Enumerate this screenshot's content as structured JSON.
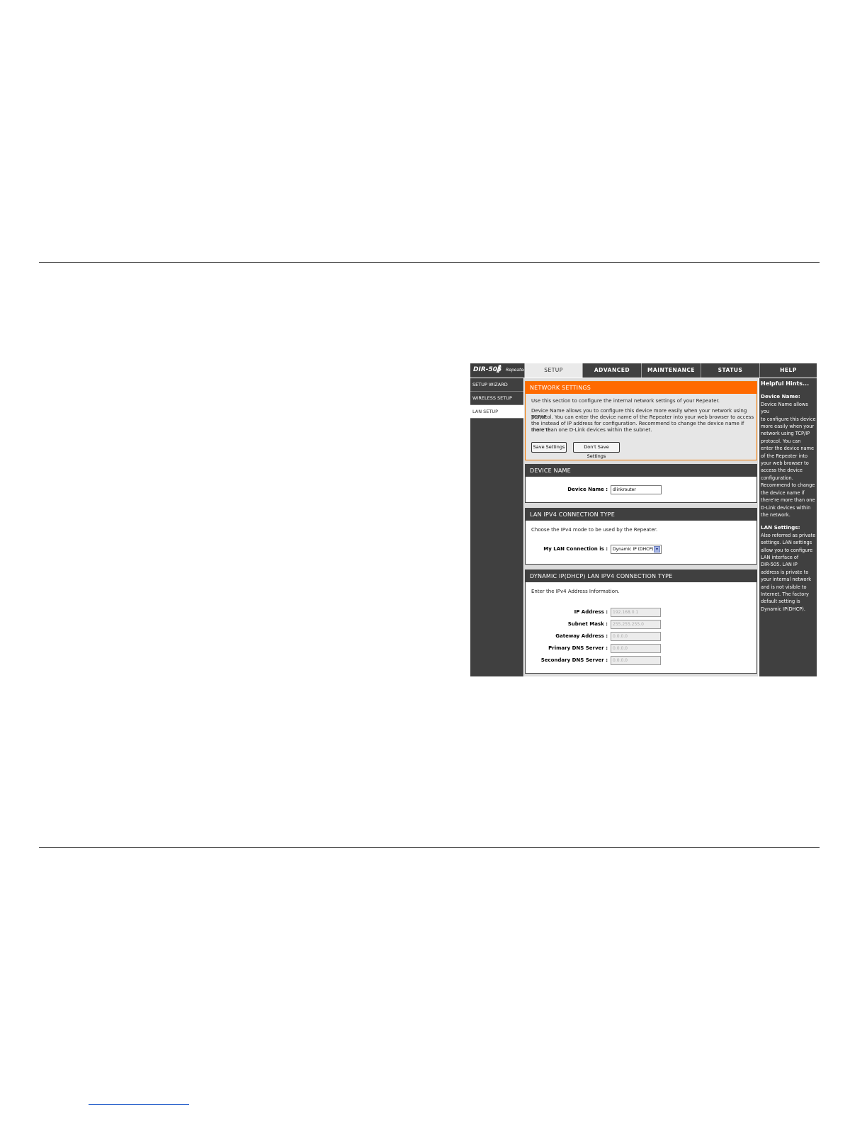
{
  "document": {
    "footer_link_text": ""
  },
  "app": {
    "model": "DIR-505",
    "mode": "Repeater"
  },
  "tabs": [
    {
      "label": "SETUP",
      "active": true
    },
    {
      "label": "ADVANCED",
      "active": false
    },
    {
      "label": "MAINTENANCE",
      "active": false
    },
    {
      "label": "STATUS",
      "active": false
    },
    {
      "label": "HELP",
      "active": false
    }
  ],
  "sidebar": {
    "items": [
      {
        "label": "SETUP WIZARD",
        "active": false
      },
      {
        "label": "WIRELESS SETUP",
        "active": false
      },
      {
        "label": "LAN SETUP",
        "active": true
      }
    ]
  },
  "network_settings": {
    "title": "NETWORK SETTINGS",
    "intro": "Use this section to configure the internal network settings of your Repeater.",
    "desc_lines": [
      "Device Name allows you to configure this device more easily when your network using TCP/IP",
      "protocol. You can enter the device name of the Repeater into your web browser to access",
      "the instead of IP address for configuration. Recommend to change the device name if there're",
      "more than one D-Link devices within the subnet."
    ],
    "save_label": "Save Settings",
    "dont_save_label": "Don't Save Settings"
  },
  "device_name": {
    "title": "DEVICE NAME",
    "label": "Device Name :",
    "value": "dlinkrouter"
  },
  "lan_type": {
    "title": "LAN IPV4 CONNECTION TYPE",
    "intro": "Choose the IPv4 mode to be used by the Repeater.",
    "label": "My LAN Connection is :",
    "selected": "Dynamic IP (DHCP)"
  },
  "dhcp": {
    "title": "DYNAMIC IP(DHCP) LAN IPV4 CONNECTION TYPE",
    "intro": "Enter the IPv4 Address Information.",
    "fields": [
      {
        "label": "IP Address :",
        "value": "192.168.0.1"
      },
      {
        "label": "Subnet Mask :",
        "value": "255.255.255.0"
      },
      {
        "label": "Gateway Address :",
        "value": "0.0.0.0"
      },
      {
        "label": "Primary DNS Server :",
        "value": "0.0.0.0"
      },
      {
        "label": "Secondary DNS Server :",
        "value": "0.0.0.0"
      }
    ]
  },
  "help": {
    "title": "Helpful Hints...",
    "sections": [
      {
        "heading": "Device Name:",
        "lines": [
          "Device Name allows you",
          "to configure this device",
          "more easily when your",
          "network using TCP/IP",
          "protocol. You can",
          "enter the device name",
          "of the Repeater into",
          "your web browser to",
          "access the device",
          "configuration.",
          "Recommend to change",
          "the device name if",
          "there're more than one",
          "D-Link devices within",
          "the network."
        ]
      },
      {
        "heading": "LAN Settings:",
        "lines": [
          "Also referred as private",
          "settings. LAN settings",
          "allow you to configure",
          "LAN interface of",
          "DIR-505. LAN IP",
          "address is private to",
          "your internal network",
          "and is not visible to",
          "Internet. The factory",
          "default setting is",
          "Dynamic IP(DHCP)."
        ]
      }
    ]
  }
}
